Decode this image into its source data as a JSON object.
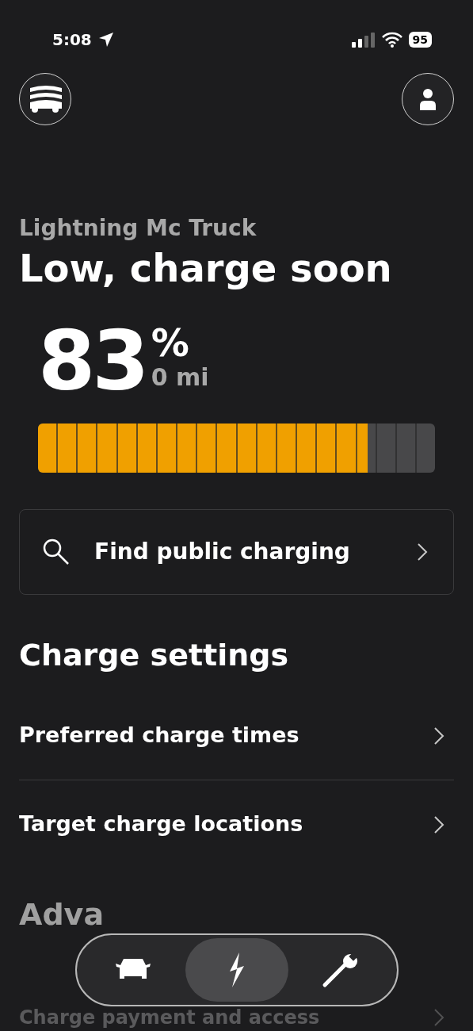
{
  "status_bar": {
    "time": "5:08",
    "battery": "95"
  },
  "vehicle_name": "Lightning Mc Truck",
  "status_title": "Low, charge soon",
  "charge": {
    "percent": "83",
    "unit": "%",
    "range": "0 mi",
    "level": 0.83
  },
  "find_charging": {
    "label": "Find public charging"
  },
  "charge_settings": {
    "heading": "Charge settings",
    "items": [
      {
        "label": "Preferred charge times"
      },
      {
        "label": "Target charge locations"
      }
    ]
  },
  "advanced": {
    "heading": "Adva",
    "items": [
      {
        "label": "Charge payment and access"
      }
    ]
  },
  "bottom_nav": [
    {
      "kind": "car",
      "selected": false
    },
    {
      "kind": "bolt",
      "selected": true
    },
    {
      "kind": "wrench",
      "selected": false
    }
  ]
}
